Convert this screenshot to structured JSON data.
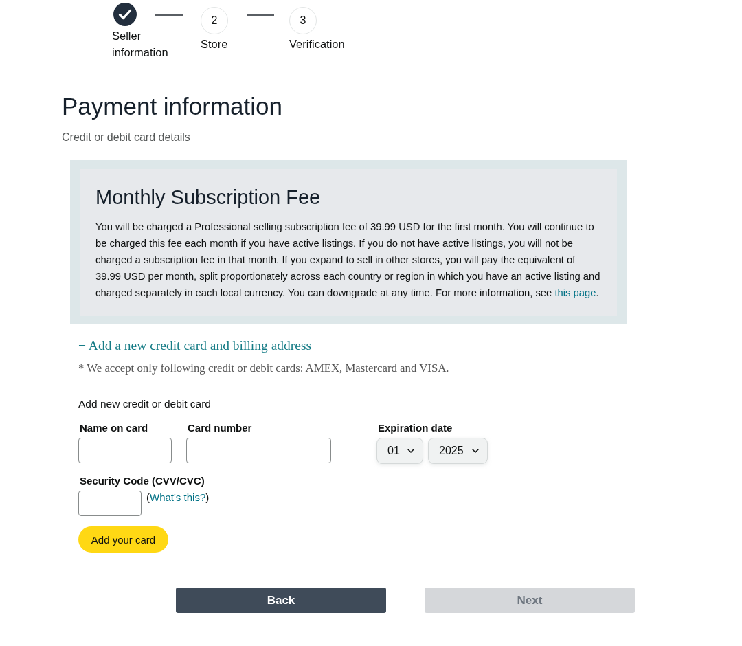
{
  "stepper": {
    "steps": [
      {
        "label": "Seller information",
        "completed": true
      },
      {
        "number": "2",
        "label": "Store",
        "completed": false
      },
      {
        "number": "3",
        "label": "Verification",
        "completed": false
      }
    ]
  },
  "page": {
    "title": "Payment information",
    "subtitle": "Credit or debit card details"
  },
  "fee_notice": {
    "title": "Monthly Subscription Fee",
    "text": "You will be charged a Professional selling subscription fee of 39.99 USD for the first month. You will continue to be charged this fee each month if you have active listings. If you do not have active listings, you will not be charged a subscription fee in that month. If you expand to sell in other stores, you will pay the equivalent of 39.99 USD per month, split proportionately across each country or region in which you have an active listing and charged separately in each local currency. You can downgrade at any time. For more information, see",
    "link": "this page",
    "text_end": "."
  },
  "add_card_link": "+ Add a new credit card and billing address",
  "accepted_cards_note": "* We accept only following credit or debit cards: AMEX, Mastercard and VISA.",
  "card_form": {
    "heading": "Add new credit or debit card",
    "rows": [
      [
        {
          "kind": "name",
          "label": "Name on card"
        },
        {
          "kind": "card-number",
          "label": "Card number"
        },
        {
          "kind": "expiry",
          "label": "Expiration date",
          "selects": [
            {
              "kind": "month",
              "value": "01"
            },
            {
              "kind": "year",
              "value": "2025"
            }
          ]
        }
      ],
      [
        {
          "kind": "security-code",
          "label": "Security Code (CVV/CVC)",
          "help": {
            "before": "(",
            "link": "What's this?",
            "after": ")"
          }
        }
      ]
    ],
    "submit": "Add your card"
  },
  "navigation": [
    {
      "label": "Back",
      "disabled": false
    },
    {
      "label": "Next",
      "disabled": true
    }
  ]
}
